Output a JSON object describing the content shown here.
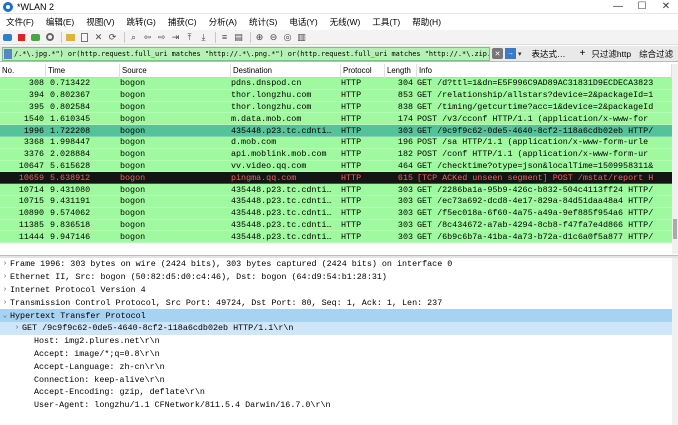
{
  "window": {
    "title": "*WLAN 2",
    "minimize": "—",
    "maximize": "☐",
    "close": "✕"
  },
  "menu": [
    "文件(F)",
    "编辑(E)",
    "视图(V)",
    "跳转(G)",
    "捕获(C)",
    "分析(A)",
    "统计(S)",
    "电话(Y)",
    "无线(W)",
    "工具(T)",
    "帮助(H)"
  ],
  "filter": {
    "text": "/.*\\.jpg.*\") or(http.request.full_uri matches \"http://.*\\.png.*\") or(http.request.full_uri matches \"http://.*\\.zip.*\")",
    "expression_label": "表达式…",
    "plus": "+",
    "bookmark1": "只过滤http",
    "bookmark2": "综合过滤"
  },
  "columns": [
    "No.",
    "Time",
    "Source",
    "Destination",
    "Protocol",
    "Length",
    "Info"
  ],
  "packets": [
    {
      "no": "308",
      "time": "0.713422",
      "src": "bogon",
      "dst": "pdns.dnspod.cn",
      "proto": "HTTP",
      "len": "304",
      "info": "GET /d?ttl=1&dn=E5F996C9AD89AC31831D9ECDECA3823",
      "style": "green"
    },
    {
      "no": "394",
      "time": "0.802367",
      "src": "bogon",
      "dst": "thor.longzhu.com",
      "proto": "HTTP",
      "len": "853",
      "info": "GET /relationship/allstars?device=2&packageId=1",
      "style": "green"
    },
    {
      "no": "395",
      "time": "0.802584",
      "src": "bogon",
      "dst": "thor.longzhu.com",
      "proto": "HTTP",
      "len": "838",
      "info": "GET /timing/getcurtime?acc=1&device=2&packageId",
      "style": "green"
    },
    {
      "no": "1540",
      "time": "1.610345",
      "src": "bogon",
      "dst": "m.data.mob.com",
      "proto": "HTTP",
      "len": "174",
      "info": "POST /v3/cconf HTTP/1.1  (application/x-www-for",
      "style": "green"
    },
    {
      "no": "1996",
      "time": "1.722208",
      "src": "bogon",
      "dst": "435448.p23.tc.cdnti…",
      "proto": "HTTP",
      "len": "303",
      "info": "GET /9c9f9c62-0de5-4640-8cf2-118a6cdb02eb HTTP/",
      "style": "selected"
    },
    {
      "no": "3368",
      "time": "1.998447",
      "src": "bogon",
      "dst": "d.mob.com",
      "proto": "HTTP",
      "len": "196",
      "info": "POST /sa HTTP/1.1  (application/x-www-form-urle",
      "style": "green"
    },
    {
      "no": "3376",
      "time": "2.028884",
      "src": "bogon",
      "dst": "api.moblink.mob.com",
      "proto": "HTTP",
      "len": "182",
      "info": "POST /conf HTTP/1.1  (application/x-www-form-ur",
      "style": "green"
    },
    {
      "no": "10647",
      "time": "5.615628",
      "src": "bogon",
      "dst": "vv.video.qq.com",
      "proto": "HTTP",
      "len": "464",
      "info": "GET /checktime?otype=json&localTime=1509958311&",
      "style": "green"
    },
    {
      "no": "10659",
      "time": "5.638912",
      "src": "bogon",
      "dst": "pingma.qq.com",
      "proto": "HTTP",
      "len": "615",
      "info": "[TCP ACKed unseen segment] POST /mstat/report H",
      "style": "error"
    },
    {
      "no": "10714",
      "time": "9.431080",
      "src": "bogon",
      "dst": "435448.p23.tc.cdnti…",
      "proto": "HTTP",
      "len": "303",
      "info": "GET /2286ba1a-95b9-426c-b832-504c4113ff24 HTTP/",
      "style": "green"
    },
    {
      "no": "10715",
      "time": "9.431191",
      "src": "bogon",
      "dst": "435448.p23.tc.cdnti…",
      "proto": "HTTP",
      "len": "303",
      "info": "GET /ec73a692-dcd8-4e17-829a-84d51daa48a4 HTTP/",
      "style": "green"
    },
    {
      "no": "10890",
      "time": "9.574062",
      "src": "bogon",
      "dst": "435448.p23.tc.cdnti…",
      "proto": "HTTP",
      "len": "303",
      "info": "GET /f5ec018a-6f60-4a75-a49a-9ef885f954a6 HTTP/",
      "style": "green"
    },
    {
      "no": "11385",
      "time": "9.836518",
      "src": "bogon",
      "dst": "435448.p23.tc.cdnti…",
      "proto": "HTTP",
      "len": "303",
      "info": "GET /8c434672-a7ab-4294-8cb8-f47fa7e4d866 HTTP/",
      "style": "green"
    },
    {
      "no": "11444",
      "time": "9.947146",
      "src": "bogon",
      "dst": "435448.p23.tc.cdnti…",
      "proto": "HTTP",
      "len": "303",
      "info": "GET /6b9c6b7a-41ba-4a73-b72a-d1c6a0f5a877 HTTP/",
      "style": "green"
    }
  ],
  "details": [
    {
      "text": "Frame 1996: 303 bytes on wire (2424 bits), 303 bytes captured (2424 bits) on interface 0",
      "arrow": "›",
      "level": 0,
      "style": ""
    },
    {
      "text": "Ethernet II, Src: bogon (50:82:d5:d0:c4:46), Dst: bogon (64:d9:54:b1:28:31)",
      "arrow": "›",
      "level": 0,
      "style": ""
    },
    {
      "text": "Internet Protocol Version 4",
      "arrow": "›",
      "level": 0,
      "style": ""
    },
    {
      "text": "Transmission Control Protocol, Src Port: 49724, Dst Port: 80, Seq: 1, Ack: 1, Len: 237",
      "arrow": "›",
      "level": 0,
      "style": ""
    },
    {
      "text": "Hypertext Transfer Protocol",
      "arrow": "⌄",
      "level": 0,
      "style": "hl"
    },
    {
      "text": "GET /9c9f9c62-0de5-4640-8cf2-118a6cdb02eb HTTP/1.1\\r\\n",
      "arrow": "›",
      "level": 1,
      "style": "hl2"
    },
    {
      "text": "Host: img2.plures.net\\r\\n",
      "arrow": "",
      "level": 2,
      "style": ""
    },
    {
      "text": "Accept: image/*;q=0.8\\r\\n",
      "arrow": "",
      "level": 2,
      "style": ""
    },
    {
      "text": "Accept-Language: zh-cn\\r\\n",
      "arrow": "",
      "level": 2,
      "style": ""
    },
    {
      "text": "Connection: keep-alive\\r\\n",
      "arrow": "",
      "level": 2,
      "style": ""
    },
    {
      "text": "Accept-Encoding: gzip, deflate\\r\\n",
      "arrow": "",
      "level": 2,
      "style": ""
    },
    {
      "text": "User-Agent: longzhu/1.1 CFNetwork/811.5.4 Darwin/16.7.0\\r\\n",
      "arrow": "",
      "level": 2,
      "style": ""
    }
  ]
}
